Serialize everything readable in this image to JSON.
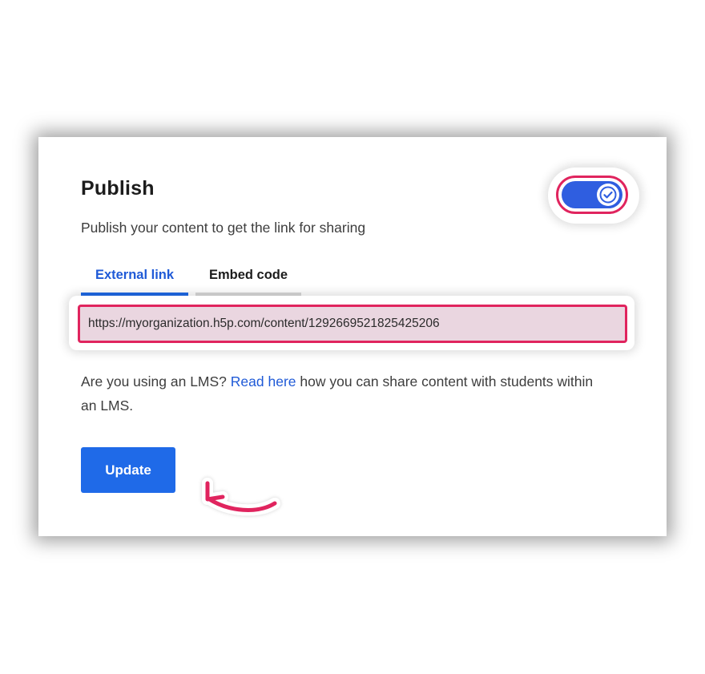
{
  "publish": {
    "title": "Publish",
    "description": "Publish your content to get the link for sharing",
    "toggle_on": true
  },
  "tabs": [
    {
      "label": "External link",
      "active": true
    },
    {
      "label": "Embed code",
      "active": false
    }
  ],
  "link": {
    "value": "https://myorganization.h5p.com/content/1292669521825425206"
  },
  "lms_note": {
    "prefix": "Are you using an LMS? ",
    "link_text": "Read here",
    "suffix": " how you can share content with students within an LMS."
  },
  "update_button": {
    "label": "Update"
  },
  "colors": {
    "accent_blue": "#1f6ae8",
    "toggle_blue": "#2f5ee0",
    "highlight_pink": "#e0245e",
    "field_fill": "#ead6e0"
  },
  "icons": {
    "toggle_knob": "check-icon",
    "annotation": "curved-arrow-icon"
  }
}
